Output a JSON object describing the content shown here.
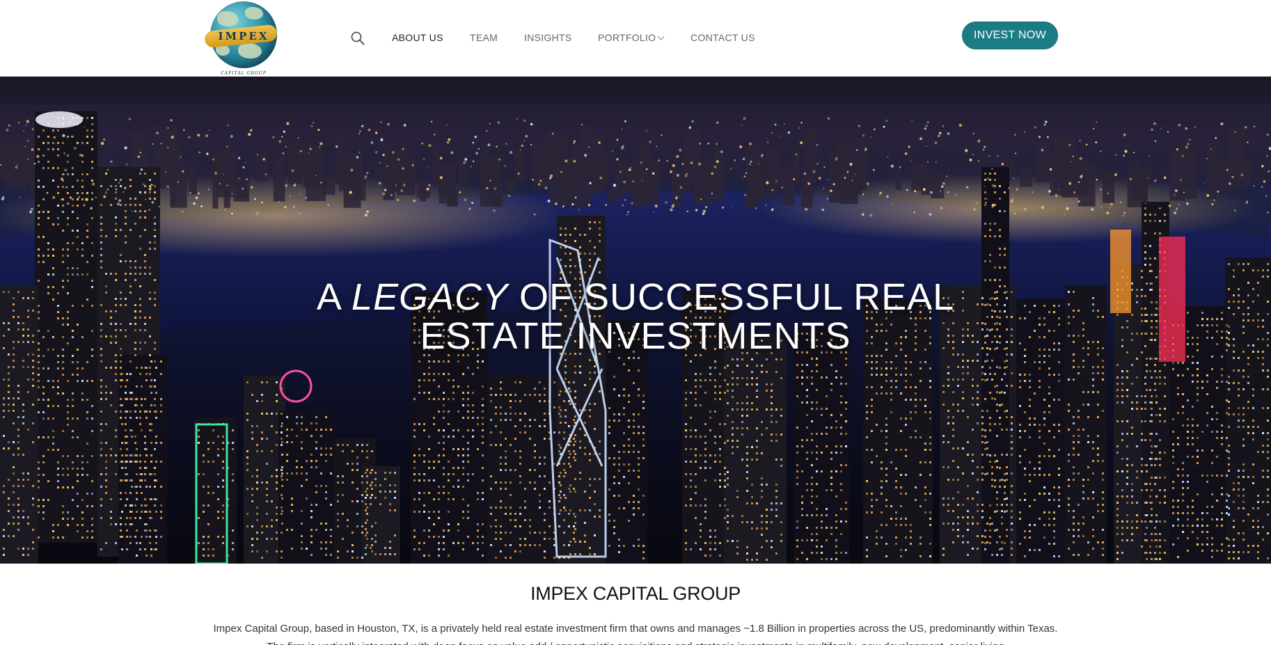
{
  "header": {
    "logo": {
      "text": "IMPEX",
      "subtext": "CAPITAL GROUP"
    },
    "search_icon": "search-icon",
    "nav": [
      {
        "label": "ABOUT US",
        "active": true
      },
      {
        "label": "TEAM",
        "active": false
      },
      {
        "label": "INSIGHTS",
        "active": false
      },
      {
        "label": "PORTFOLIO",
        "active": false,
        "has_dropdown": true
      },
      {
        "label": "CONTACT US",
        "active": false
      }
    ],
    "cta_label": "INVEST NOW",
    "cta_color": "#1b7c85"
  },
  "hero": {
    "title_part1": "A ",
    "title_emphasis": "LEGACY",
    "title_part2": " OF SUCCESSFUL REAL",
    "title_line2": "ESTATE INVESTMENTS"
  },
  "intro": {
    "heading": "IMPEX CAPITAL GROUP",
    "body": "Impex Capital Group, based in Houston, TX, is a privately held real estate investment firm that owns and manages ~1.8 Billion in properties across the US, predominantly within Texas. The firm is vertically integrated with deep focus on value add / opportunistic acquisitions and strategic investments in multifamily, new development, senior living"
  }
}
